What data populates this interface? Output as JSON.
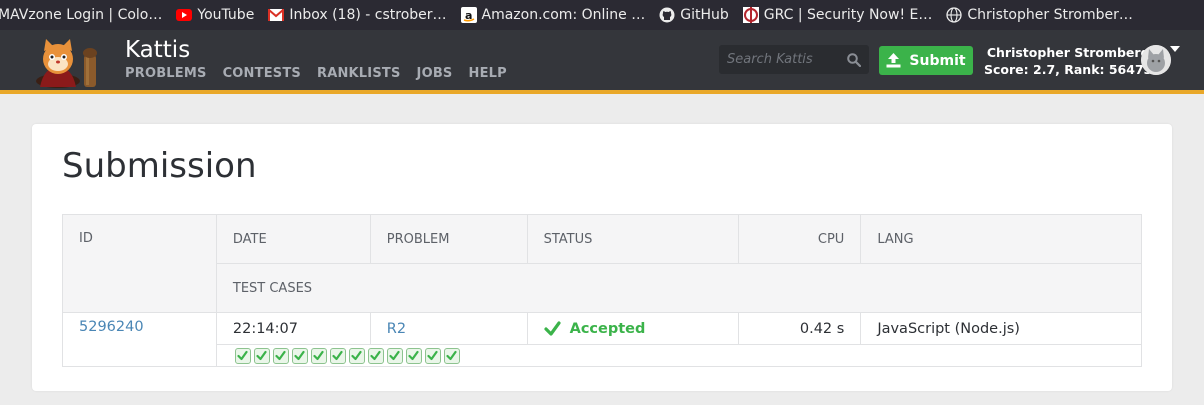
{
  "bookmarks": [
    {
      "label": "MAVzone Login | Colo…",
      "icon": "mavzone-icon"
    },
    {
      "label": "YouTube",
      "icon": "youtube-icon"
    },
    {
      "label": "Inbox (18) - cstrober…",
      "icon": "gmail-icon"
    },
    {
      "label": "Amazon.com: Online …",
      "icon": "amazon-icon"
    },
    {
      "label": "GitHub",
      "icon": "github-icon"
    },
    {
      "label": "GRC | Security Now! E…",
      "icon": "grc-icon"
    },
    {
      "label": "Christopher Stromber…",
      "icon": "globe-icon"
    }
  ],
  "header": {
    "brand": "Kattis",
    "nav": [
      "PROBLEMS",
      "CONTESTS",
      "RANKLISTS",
      "JOBS",
      "HELP"
    ],
    "search_placeholder": "Search Kattis",
    "submit_label": "Submit",
    "user_name": "Christopher Stromberg",
    "user_stats": "Score: 2.7, Rank: 56473",
    "accent_color": "#e9a829",
    "submit_color": "#3bb34a"
  },
  "page": {
    "title": "Submission"
  },
  "table": {
    "headers": {
      "id": "ID",
      "date": "DATE",
      "problem": "PROBLEM",
      "status": "STATUS",
      "cpu": "CPU",
      "lang": "LANG",
      "test_cases": "TEST CASES"
    },
    "row": {
      "id": "5296240",
      "date": "22:14:07",
      "problem": "R2",
      "status": "Accepted",
      "cpu": "0.42 s",
      "lang": "JavaScript (Node.js)"
    },
    "test_case_count": 12,
    "test_case_status": "accepted"
  }
}
